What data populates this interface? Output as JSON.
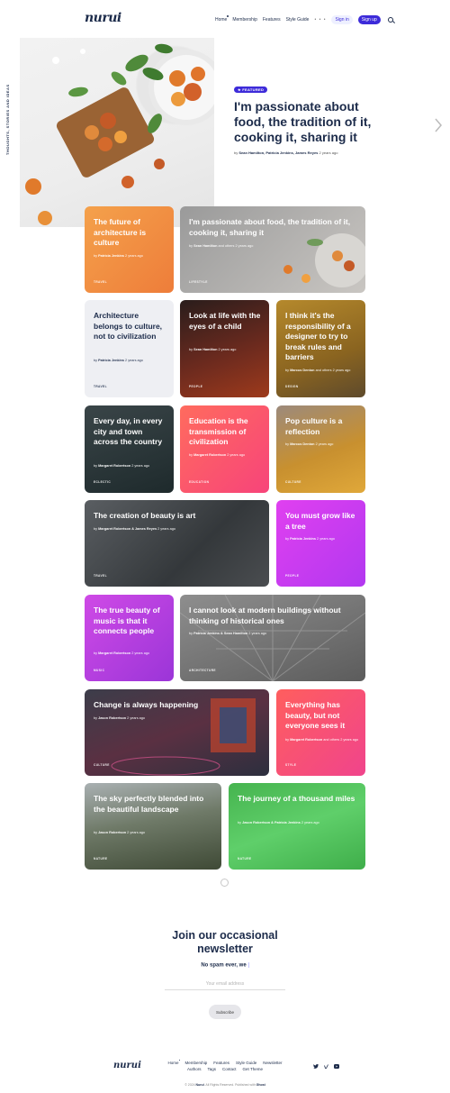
{
  "header": {
    "logo": "nurui",
    "nav": [
      "Home",
      "Membership",
      "Features",
      "Style Guide"
    ],
    "more": "• • •",
    "signin": "Sign in",
    "signup": "Sign up"
  },
  "hero": {
    "side_label": "THOUGHTS, STORIES AND IDEAS",
    "badge": "★ FEATURED",
    "title": "I'm passionate about food, the tradition of it, cooking it, sharing it",
    "by": "by",
    "authors": "Sean Hamilton, Patricia Jenkins, James Reyes",
    "time": " 2 years ago"
  },
  "cards": [
    {
      "title": "The future of architecture is culture",
      "by": "by",
      "author": "Patricia Jenkins",
      "time": " 2 years ago",
      "tag": "TRAVEL"
    },
    {
      "title": "I'm passionate about food, the tradition of it, cooking it, sharing it",
      "by": "by",
      "author": "Sean Hamilton",
      "time": " and others 2 years ago",
      "tag": "LIFESTYLE"
    },
    {
      "title": "Architecture belongs to culture, not to civilization",
      "by": "by",
      "author": "Patricia Jenkins",
      "time": " 2 years ago",
      "tag": "TRAVEL"
    },
    {
      "title": "Look at life with the eyes of a child",
      "by": "by",
      "author": "Sean Hamilton",
      "time": " 2 years ago",
      "tag": "PEOPLE"
    },
    {
      "title": "I think it's the responsibility of a designer to try to break rules and barriers",
      "by": "by",
      "author": "Marcus Denton",
      "time": " and others 2 years ago",
      "tag": "DESIGN"
    },
    {
      "title": "Every day, in every city and town across the country",
      "by": "by",
      "author": "Margaret Robertson",
      "time": " 2 years ago",
      "tag": "ECLECTIC"
    },
    {
      "title": "Education is the transmission of civilization",
      "by": "by",
      "author": "Margaret Robertson",
      "time": " 2 years ago",
      "tag": "EDUCATION"
    },
    {
      "title": "Pop culture is a reflection",
      "by": "by",
      "author": "Marcus Denton",
      "time": " 2 years ago",
      "tag": "CULTURE"
    },
    {
      "title": "The creation of beauty is art",
      "by": "by",
      "author": "Margaret Robertson & James Reyes",
      "time": " 2 years ago",
      "tag": "TRAVEL"
    },
    {
      "title": "You must grow like a tree",
      "by": "by",
      "author": "Patricia Jenkins",
      "time": " 2 years ago",
      "tag": "PEOPLE"
    },
    {
      "title": "The true beauty of music is that it connects people",
      "by": "by",
      "author": "Margaret Robertson",
      "time": " 2 years ago",
      "tag": "MUSIC"
    },
    {
      "title": "I cannot look at modern buildings without thinking of historical ones",
      "by": "by",
      "author": "Patricia Jenkins & Sean Hamilton",
      "time": " 2 years ago",
      "tag": "ARCHITECTURE"
    },
    {
      "title": "Change is always happening",
      "by": "by",
      "author": "Jason Robertson",
      "time": " 2 years ago",
      "tag": "CULTURE"
    },
    {
      "title": "Everything has beauty, but not everyone sees it",
      "by": "by",
      "author": "Margaret Robertson",
      "time": " and others 2 years ago",
      "tag": "STYLE"
    },
    {
      "title": "The sky perfectly blended into the beautiful landscape",
      "by": "by",
      "author": "Jason Robertson",
      "time": " 2 years ago",
      "tag": "NATURE"
    },
    {
      "title": "The journey of a thousand miles",
      "by": "by",
      "author": "Jason Robertson & Patricia Jenkins",
      "time": " 2 years ago",
      "tag": "NATURE"
    }
  ],
  "newsletter": {
    "title": "Join our occasional newsletter",
    "subtitle": "No spam ever, we",
    "placeholder": "Your email address",
    "button": "Subscribe"
  },
  "footer": {
    "logo": "nurui",
    "links": [
      "Home",
      "Membership",
      "Features",
      "Style Guide",
      "Newsletter",
      "Authors",
      "Tags",
      "Contact",
      "Get Theme"
    ],
    "copyright_prefix": "© 2024 ",
    "copyright_brand": "Nurui",
    "copyright_suffix": ". All Rights Reserved. Published with ",
    "copyright_ghost": "Ghost"
  }
}
